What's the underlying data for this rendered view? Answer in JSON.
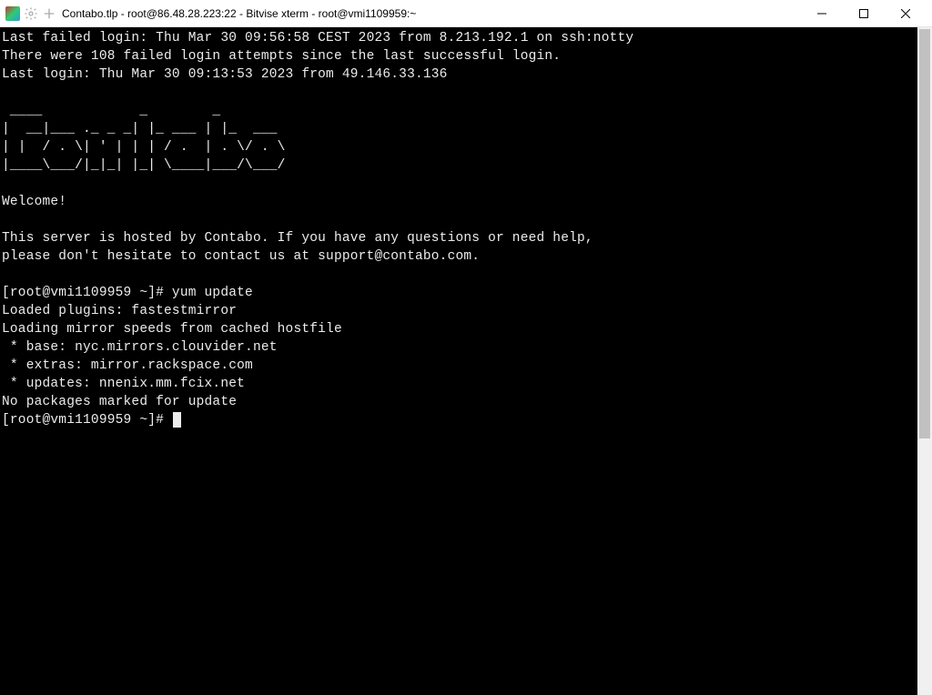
{
  "window": {
    "title": "Contabo.tlp - root@86.48.28.223:22 - Bitvise xterm - root@vmi1109959:~"
  },
  "terminal": {
    "last_failed": "Last failed login: Thu Mar 30 09:56:58 CEST 2023 from 8.213.192.1 on ssh:notty",
    "failed_attempts": "There were 108 failed login attempts since the last successful login.",
    "last_login": "Last login: Thu Mar 30 09:13:53 2023 from 49.146.33.136",
    "ascii1": " ____            _        _           ",
    "ascii2": "|  __|___ ._ _ _| |_ ___ | |_  ___    ",
    "ascii3": "| |  / . \\| ' | | | / .  | . \\/ . \\   ",
    "ascii4": "|____\\___/|_|_| |_| \\____|___/\\___/   ",
    "welcome": "Welcome!",
    "host1": "This server is hosted by Contabo. If you have any questions or need help,",
    "host2": "please don't hesitate to contact us at support@contabo.com.",
    "prompt1": "[root@vmi1109959 ~]# yum update",
    "loaded": "Loaded plugins: fastestmirror",
    "loading": "Loading mirror speeds from cached hostfile",
    "mirror_base": " * base: nyc.mirrors.clouvider.net",
    "mirror_extras": " * extras: mirror.rackspace.com",
    "mirror_updates": " * updates: nnenix.mm.fcix.net",
    "nopkg": "No packages marked for update",
    "prompt2": "[root@vmi1109959 ~]# "
  }
}
